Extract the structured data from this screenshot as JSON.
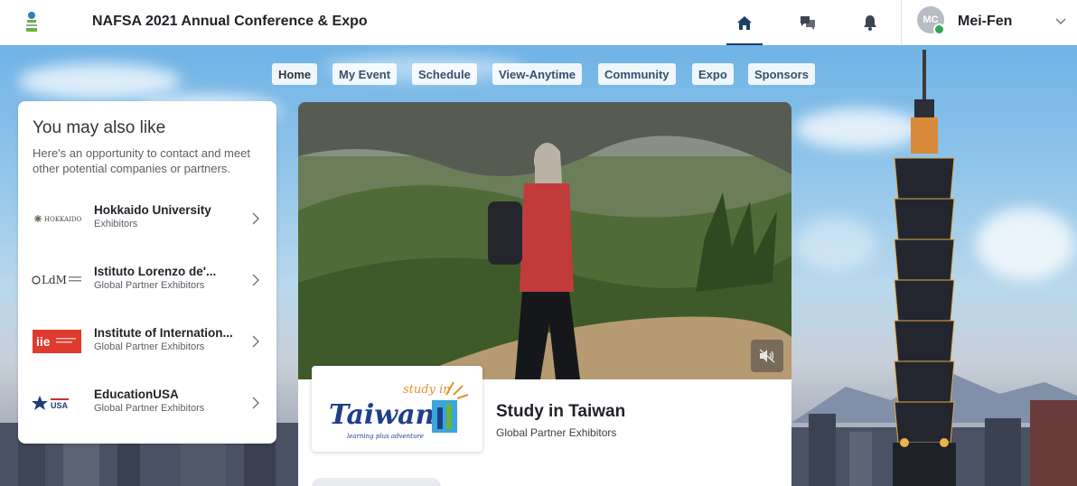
{
  "header": {
    "app_title": "NAFSA 2021 Annual Conference & Expo",
    "icons": [
      "home-icon",
      "chat-icon",
      "bell-icon"
    ],
    "active_icon": "home-icon",
    "user": {
      "initials": "MC",
      "name": "Mei-Fen",
      "status": "online"
    }
  },
  "nav": {
    "tabs": [
      {
        "label": "Home"
      },
      {
        "label": "My Event"
      },
      {
        "label": "Schedule"
      },
      {
        "label": "View-Anytime"
      },
      {
        "label": "Community"
      },
      {
        "label": "Expo"
      },
      {
        "label": "Sponsors"
      }
    ],
    "current": "Home"
  },
  "suggestions": {
    "title": "You may also like",
    "description": "Here's an opportunity to contact and meet other potential companies or partners.",
    "items": [
      {
        "name": "Hokkaido University",
        "type": "Exhibitors",
        "logo": "hokkaido-logo",
        "logo_text": "HOKKAIDO"
      },
      {
        "name": "Istituto Lorenzo de'...",
        "type": "Global Partner Exhibitors",
        "logo": "ldm-logo",
        "logo_text": "LdM"
      },
      {
        "name": "Institute of Internation...",
        "type": "Global Partner Exhibitors",
        "logo": "iie-logo",
        "logo_text": "iie"
      },
      {
        "name": "EducationUSA",
        "type": "Global Partner Exhibitors",
        "logo": "educationusa-logo",
        "logo_text": "USA"
      }
    ]
  },
  "featured": {
    "name": "Study in Taiwan",
    "type": "Global Partner Exhibitors",
    "logo_text": "Taiwan",
    "logo_script": "study in",
    "logo_tagline": "learning plus adventure",
    "media_state": "muted"
  },
  "colors": {
    "accent": "#1d3f66",
    "online": "#2fa84f",
    "iie_red": "#e03a2f"
  }
}
